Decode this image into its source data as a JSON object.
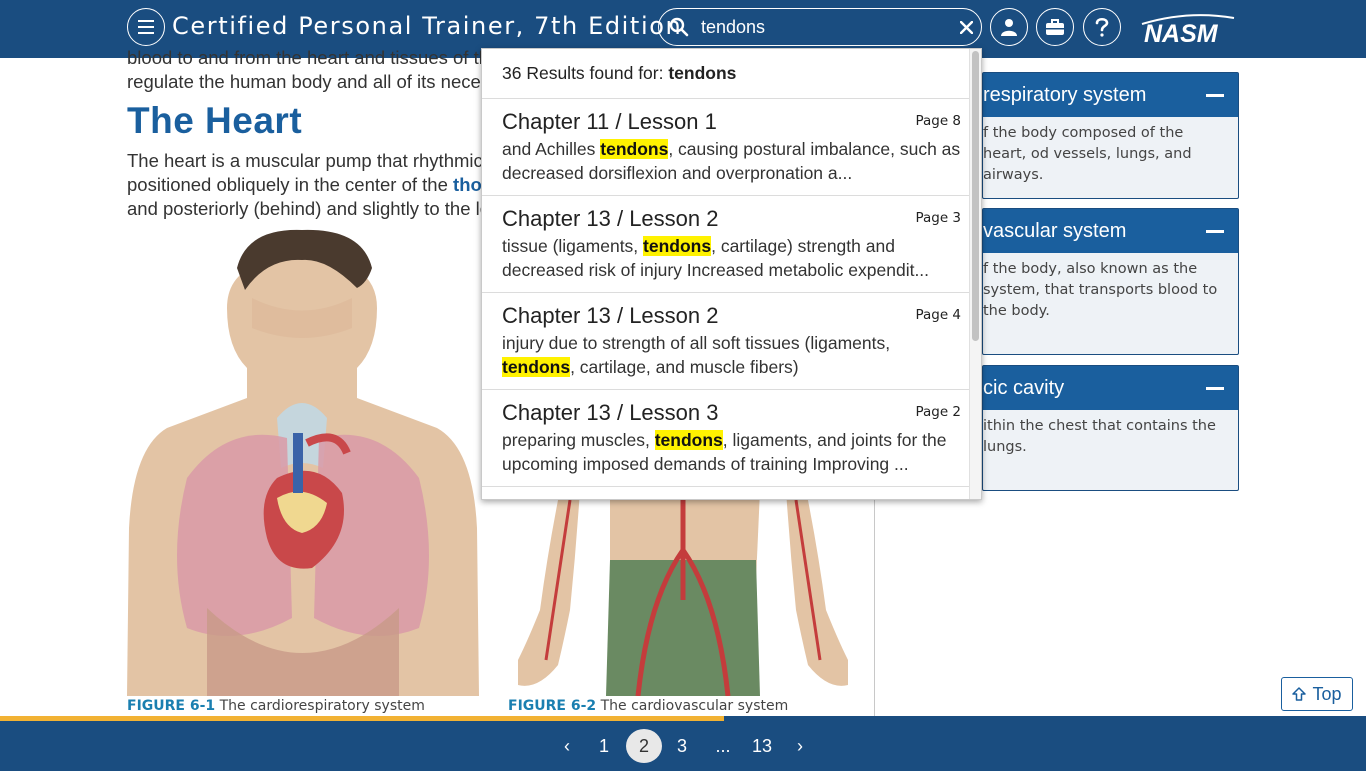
{
  "header": {
    "title": "Certified Personal Trainer, 7th Edition",
    "search_value": "tendons",
    "logo_text": "NASM"
  },
  "content": {
    "intro_lines": [
      "blood to and from the heart and tissues of the b",
      "regulate the human body and all of its necessary"
    ],
    "heading": "The Heart",
    "body_lines": [
      "The heart is a muscular pump that rhythmically",
      "positioned obliquely in the center of the",
      "and posteriorly (behind) and slightly to the left of"
    ],
    "body_link": "thorac",
    "figures": [
      {
        "number": "FIGURE 6-1",
        "caption": "The cardiorespiratory system"
      },
      {
        "number": "FIGURE 6-2",
        "caption": "The cardiovascular system"
      }
    ]
  },
  "search_results": {
    "summary_prefix": "36 Results found for:",
    "summary_term": "tendons",
    "items": [
      {
        "title": "Chapter 11 / Lesson 1",
        "page": "Page 8",
        "before": "and Achilles ",
        "match": "tendons",
        "after": ", causing postural imbalance, such as decreased dorsiflexion and overpronation a..."
      },
      {
        "title": "Chapter 13 / Lesson 2",
        "page": "Page 3",
        "before": "tissue (ligaments, ",
        "match": "tendons",
        "after": ", cartilage) strength and decreased risk of injury Increased metabolic expendit..."
      },
      {
        "title": "Chapter 13 / Lesson 2",
        "page": "Page 4",
        "before": "injury due to strength of all soft tissues (ligaments, ",
        "match": "tendons",
        "after": ", cartilage, and muscle fibers)"
      },
      {
        "title": "Chapter 13 / Lesson 3",
        "page": "Page 2",
        "before": "preparing muscles, ",
        "match": "tendons",
        "after": ", ligaments, and joints for the upcoming imposed demands of training Improving ..."
      }
    ]
  },
  "glossary": [
    {
      "title": "respiratory system",
      "body": "f the body composed of the heart, od vessels, lungs, and airways."
    },
    {
      "title": "vascular system",
      "body": "f the body, also known as the system, that transports blood to the body."
    },
    {
      "title": "cic cavity",
      "body": "ithin the chest that contains the lungs."
    }
  ],
  "top_button": {
    "label": "Top"
  },
  "pagination": {
    "prev": "‹",
    "pages": [
      "1",
      "2",
      "3",
      "...",
      "13"
    ],
    "current": "2",
    "next": "›",
    "progress": 0.53
  },
  "colors": {
    "header_bg": "#1a4d80",
    "accent_blue": "#1a5f9e",
    "highlight": "#fff200",
    "progress": "#f2b233"
  },
  "icons": [
    "menu-icon",
    "search-icon",
    "clear-icon",
    "user-icon",
    "briefcase-icon",
    "help-icon",
    "nasm-logo",
    "arrow-up-icon",
    "chevron-left-icon",
    "chevron-right-icon"
  ]
}
